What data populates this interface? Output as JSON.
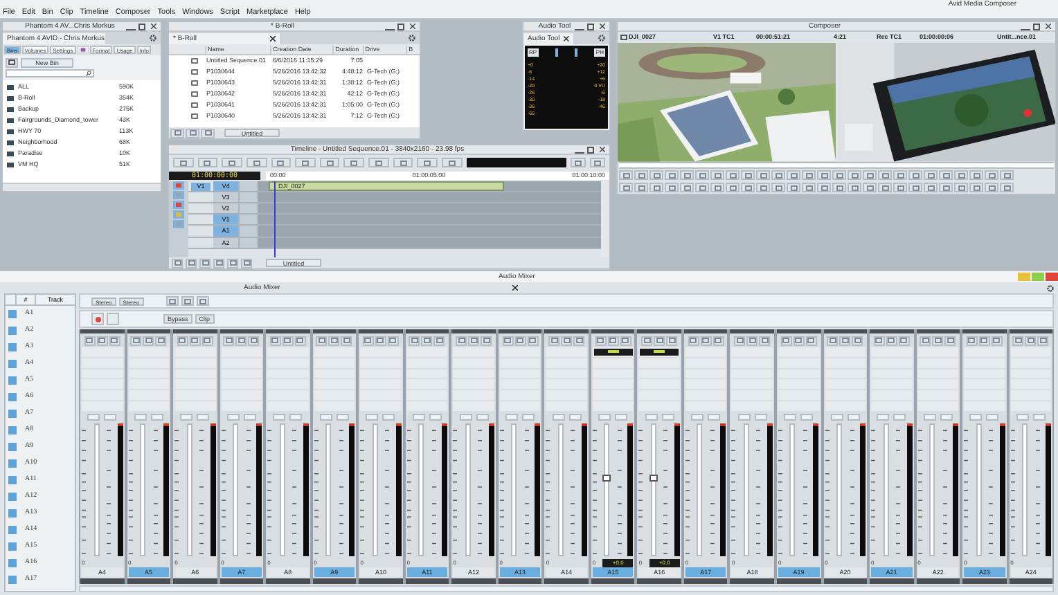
{
  "app_title": "Avid Media Composer",
  "menu": [
    "File",
    "Edit",
    "Bin",
    "Clip",
    "Timeline",
    "Composer",
    "Tools",
    "Windows",
    "Script",
    "Marketplace",
    "Help"
  ],
  "project": {
    "title": "Phantom 4 AV...Chris Morkus",
    "tab": "Phantom 4 AVID - Chris Morkus",
    "tabs": [
      {
        "label": "Bins",
        "selected": true
      },
      {
        "label": "Volumes",
        "selected": false
      },
      {
        "label": "Settings",
        "selected": false
      },
      {
        "label": "Format",
        "selected": false
      },
      {
        "label": "Usage",
        "selected": false
      },
      {
        "label": "Info",
        "selected": false
      }
    ],
    "new_bin": "New Bin",
    "bins": [
      {
        "name": "ALL",
        "size": "590K"
      },
      {
        "name": "B-Roll",
        "size": "354K"
      },
      {
        "name": "Backup",
        "size": "275K"
      },
      {
        "name": "Fairgrounds_Diamond_tower",
        "size": "43K"
      },
      {
        "name": "HWY 70",
        "size": "113K"
      },
      {
        "name": "Neighborhood",
        "size": "68K"
      },
      {
        "name": "Paradise",
        "size": "10K"
      },
      {
        "name": "VM HQ",
        "size": "51K"
      }
    ]
  },
  "bin": {
    "title": "* B-Roll",
    "tab": "* B-Roll",
    "columns": [
      "Name",
      "Creation Date",
      "Duration",
      "Drive",
      "B"
    ],
    "rows": [
      [
        "Untitled Sequence.01",
        "6/6/2016 11:15:29",
        "7:05",
        ""
      ],
      [
        "P1030644",
        "5/26/2016 13:42:32",
        "4:48:12",
        "G-Tech (G:)"
      ],
      [
        "P1030643",
        "5/26/2016 13:42:31",
        "1:38:12",
        "G-Tech (G:)"
      ],
      [
        "P1030642",
        "5/26/2016 13:42:31",
        "42:12",
        "G-Tech (G:)"
      ],
      [
        "P1030641",
        "5/26/2016 13:42:31",
        "1:05:00",
        "G-Tech (G:)"
      ],
      [
        "P1030640",
        "5/26/2016 13:42:31",
        "7:12",
        "G-Tech (G:)"
      ]
    ],
    "view": "Untitled"
  },
  "audio_tool": {
    "title": "Audio Tool",
    "tab": "Audio Tool",
    "buttons": [
      "RP",
      "PH"
    ],
    "left_scale": [
      "+0",
      "-6",
      "-14",
      "-20",
      "-26",
      "-30",
      "-36",
      "-65"
    ],
    "right_scale": [
      "+20",
      "+12",
      "+6",
      "0 VU",
      "-6",
      "-18",
      "-46"
    ]
  },
  "timeline": {
    "title": "Timeline - Untitled Sequence.01 - 3840x2160 - 23.98 fps",
    "timecode": "01:00:00:00",
    "ruler": [
      "00:00",
      "01:00:05:00",
      "01:00:10:00"
    ],
    "tracks": [
      {
        "label": "V4",
        "source": "V1",
        "selected": true
      },
      {
        "label": "V3",
        "selected": false
      },
      {
        "label": "V2",
        "selected": false
      },
      {
        "label": "V1",
        "selected": true
      },
      {
        "label": "A1",
        "selected": true
      },
      {
        "label": "A2",
        "selected": false
      }
    ],
    "clip": "DJI_0027",
    "view": "Untitled"
  },
  "composer": {
    "title": "Composer",
    "clip": "DJI_0027",
    "track": "V1 TC1",
    "source_tc": "00:00:51:21",
    "duration": "4:21",
    "rec_label": "Rec TC1",
    "record_tc": "01:00:00:06",
    "sequence": "Untit...nce.01"
  },
  "mixer": {
    "title": "Audio Mixer",
    "tab": "Audio Mixer",
    "columns": [
      "#",
      "Track"
    ],
    "tracks": [
      {
        "label": "A1",
        "checked": true
      },
      {
        "label": "A2",
        "checked": true
      },
      {
        "label": "A3",
        "checked": true
      },
      {
        "label": "A4",
        "checked": true
      },
      {
        "label": "A5",
        "checked": true
      },
      {
        "label": "A6",
        "checked": true
      },
      {
        "label": "A7",
        "checked": true
      },
      {
        "label": "A8",
        "checked": true
      },
      {
        "label": "A9",
        "checked": true
      },
      {
        "label": "A10",
        "checked": true
      },
      {
        "label": "A11",
        "checked": true
      },
      {
        "label": "A12",
        "checked": true
      },
      {
        "label": "A13",
        "checked": true
      },
      {
        "label": "A14",
        "checked": true
      },
      {
        "label": "A15",
        "checked": true
      },
      {
        "label": "A16",
        "checked": true
      },
      {
        "label": "A17",
        "checked": true
      }
    ],
    "modes": [
      "Stereo",
      "Stereo"
    ],
    "bypass": "Bypass",
    "clip": "Clip",
    "strips": [
      {
        "label": "A4",
        "selected": false,
        "pan": "0"
      },
      {
        "label": "A5",
        "selected": true,
        "pan": "0"
      },
      {
        "label": "A6",
        "selected": false,
        "pan": "0"
      },
      {
        "label": "A7",
        "selected": true,
        "pan": "0"
      },
      {
        "label": "A8",
        "selected": false,
        "pan": "0"
      },
      {
        "label": "A9",
        "selected": true,
        "pan": "0"
      },
      {
        "label": "A10",
        "selected": false,
        "pan": "0"
      },
      {
        "label": "A11",
        "selected": true,
        "pan": "0"
      },
      {
        "label": "A12",
        "selected": false,
        "pan": "0"
      },
      {
        "label": "A13",
        "selected": true,
        "pan": "0"
      },
      {
        "label": "A14",
        "selected": false,
        "pan": "0"
      },
      {
        "label": "A15",
        "selected": true,
        "pan": "0",
        "readout": "+0.0"
      },
      {
        "label": "A16",
        "selected": false,
        "pan": "0",
        "readout": "+0.0"
      },
      {
        "label": "A17",
        "selected": true,
        "pan": "0"
      },
      {
        "label": "A18",
        "selected": false,
        "pan": "0"
      },
      {
        "label": "A19",
        "selected": true,
        "pan": "0"
      },
      {
        "label": "A20",
        "selected": false,
        "pan": "0"
      },
      {
        "label": "A21",
        "selected": true,
        "pan": "0"
      },
      {
        "label": "A22",
        "selected": false,
        "pan": "0"
      },
      {
        "label": "A23",
        "selected": true,
        "pan": "0"
      },
      {
        "label": "A24",
        "selected": false,
        "pan": "0"
      }
    ]
  }
}
